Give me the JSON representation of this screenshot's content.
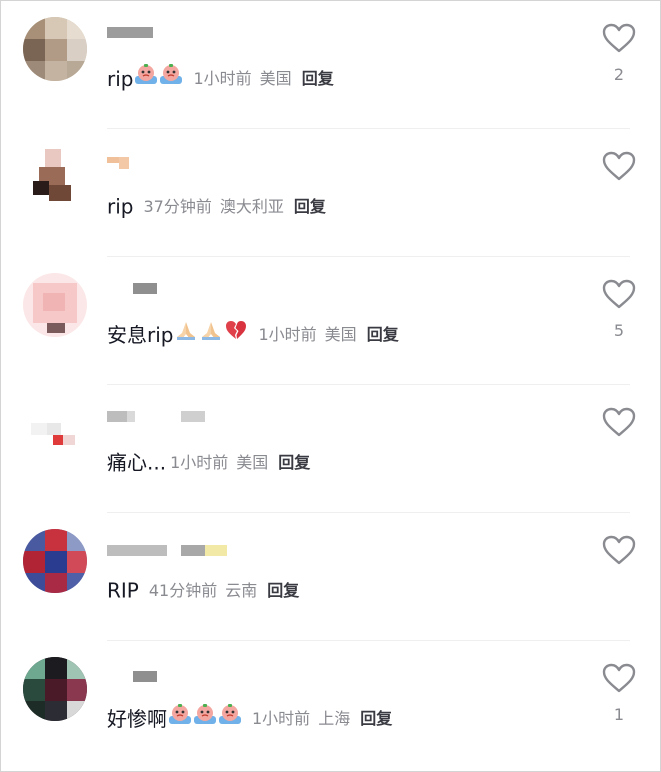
{
  "comments": [
    {
      "id": "c1",
      "body": "rip",
      "emojis": [
        "crying-face-emoji",
        "crying-face-emoji"
      ],
      "time": "1小时前",
      "location": "美国",
      "reply_label": "回复",
      "likes": "2",
      "liked": false
    },
    {
      "id": "c2",
      "body": "rip",
      "emojis": [],
      "time": "37分钟前",
      "location": "澳大利亚",
      "reply_label": "回复",
      "likes": "",
      "liked": false
    },
    {
      "id": "c3",
      "body": "安息rip",
      "emojis": [
        "folded-hands-emoji",
        "folded-hands-emoji",
        "broken-heart-emoji"
      ],
      "time": "1小时前",
      "location": "美国",
      "reply_label": "回复",
      "likes": "5",
      "liked": false
    },
    {
      "id": "c4",
      "body": "痛心...",
      "emojis": [],
      "time": "1小时前",
      "location": "美国",
      "reply_label": "回复",
      "likes": "",
      "liked": false
    },
    {
      "id": "c5",
      "body": "RIP",
      "emojis": [],
      "time": "41分钟前",
      "location": "云南",
      "reply_label": "回复",
      "likes": "",
      "liked": false
    },
    {
      "id": "c6",
      "body": "好惨啊",
      "emojis": [
        "crying-face-emoji",
        "crying-face-emoji",
        "crying-face-emoji"
      ],
      "time": "1小时前",
      "location": "上海",
      "reply_label": "回复",
      "likes": "1",
      "liked": false
    }
  ],
  "colors": {
    "text": "#161823",
    "meta": "#8a8b91",
    "reply": "#3a3b42",
    "heart_outline": "#8a8b91",
    "divider": "#efefef"
  }
}
